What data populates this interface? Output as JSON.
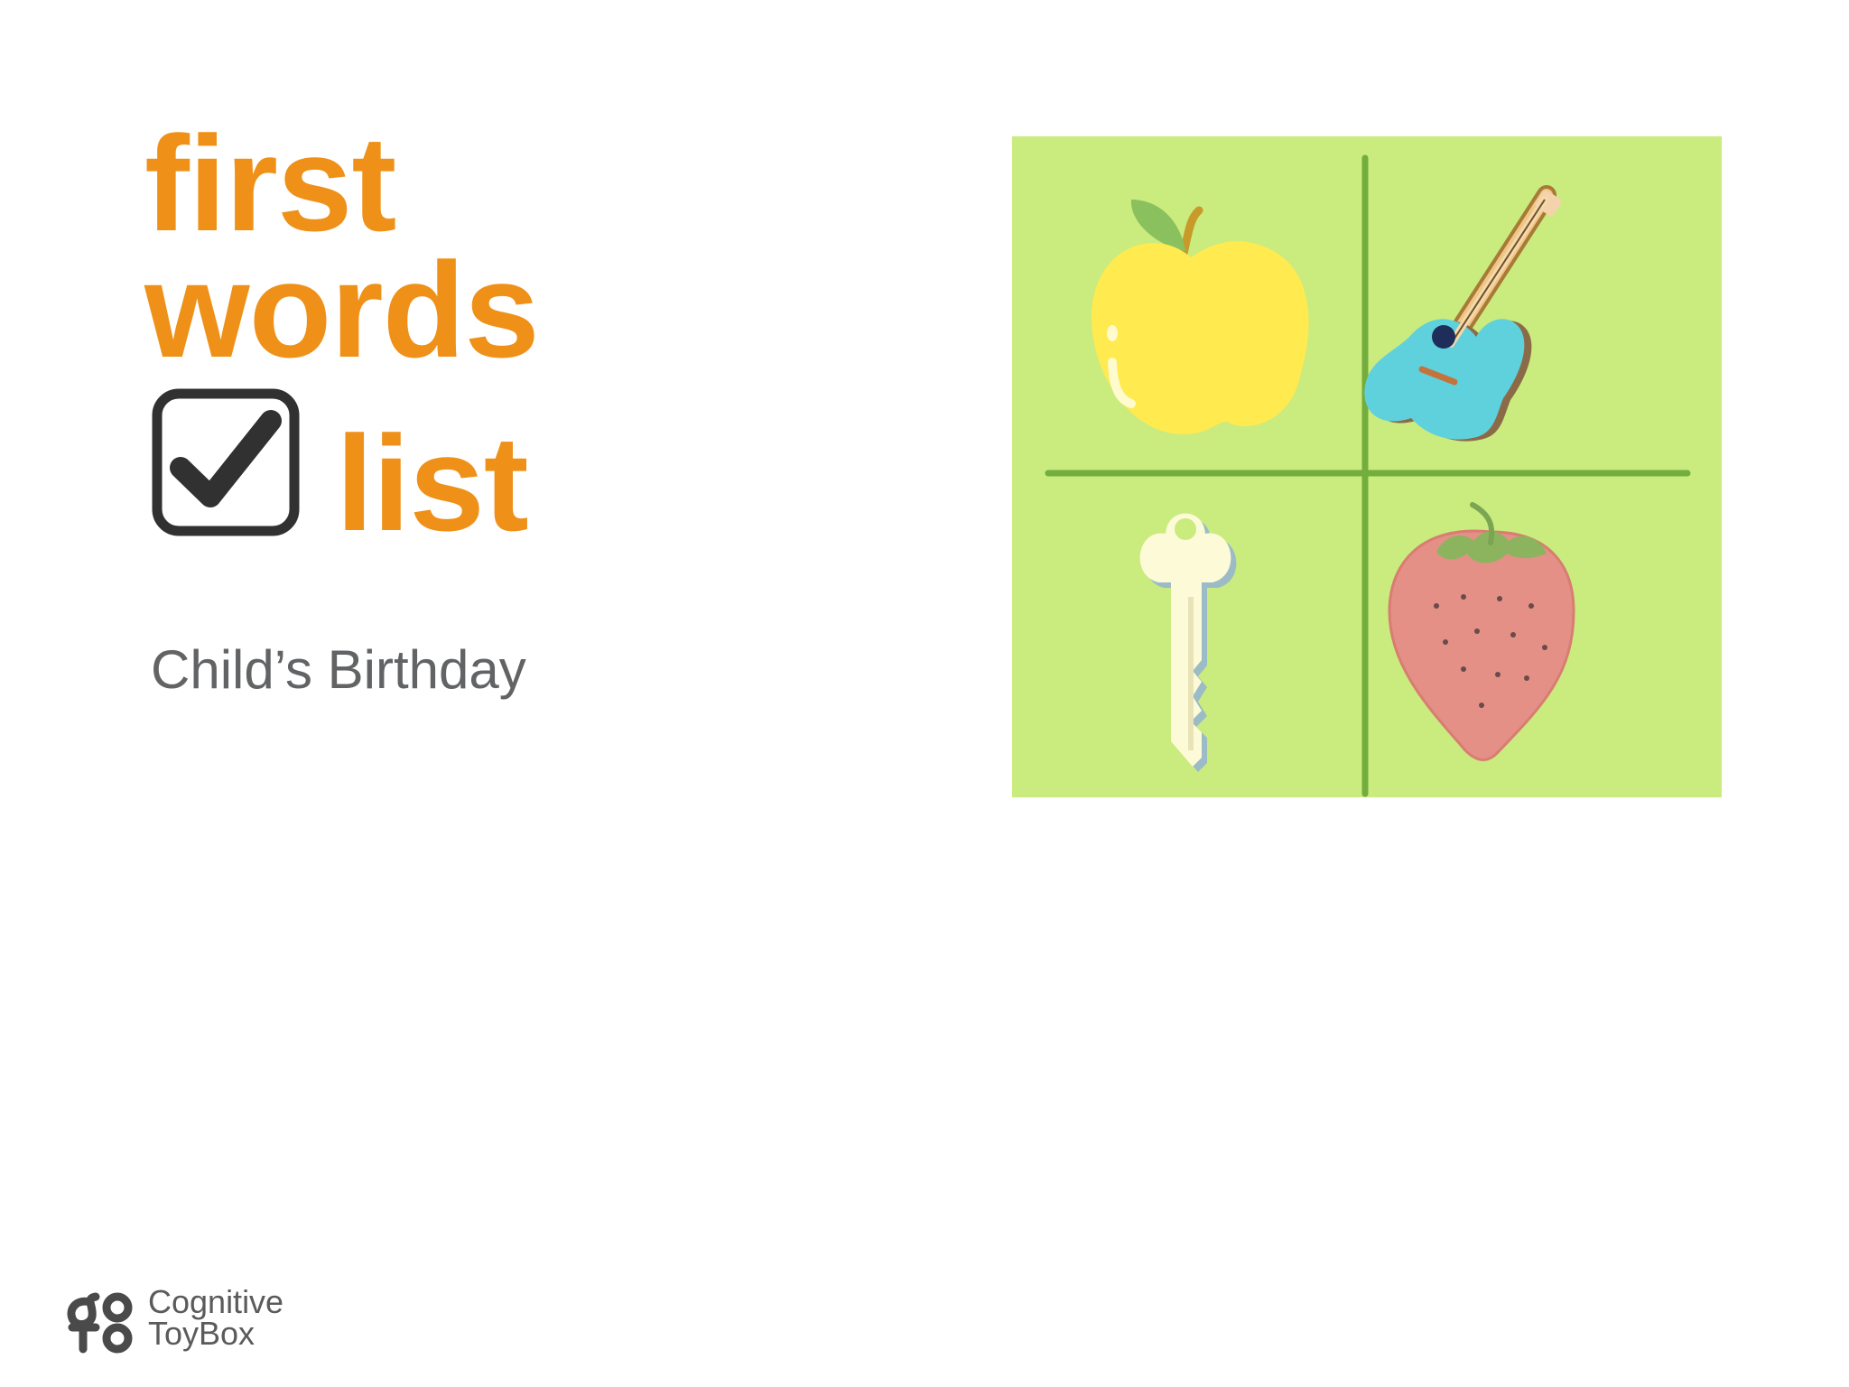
{
  "title": {
    "line1": "first",
    "line2": "words",
    "line3": "list"
  },
  "subtitle": "Child’s Birthday",
  "illustration": {
    "items": [
      "apple-icon",
      "guitar-icon",
      "key-icon",
      "strawberry-icon"
    ]
  },
  "brand": {
    "line1": "Cognitive",
    "line2": "ToyBox"
  },
  "colors": {
    "title": "#ef9118",
    "subtitle": "#616365",
    "panel_background": "#caeb7e",
    "panel_divider": "#72ad3e",
    "checkbox": "#313131"
  }
}
